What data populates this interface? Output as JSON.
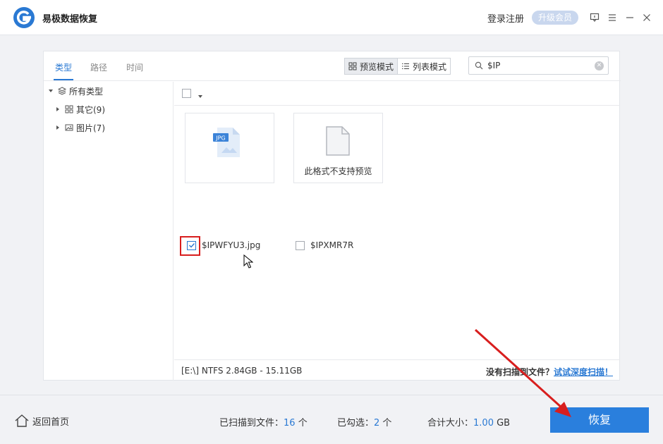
{
  "titlebar": {
    "app_title": "易极数据恢复",
    "login_label": "登录注册",
    "upgrade_label": "升级会员",
    "icons": [
      "feedback-icon",
      "menu-icon",
      "minimize-icon",
      "close-icon"
    ]
  },
  "tabs": [
    {
      "label": "类型",
      "active": true
    },
    {
      "label": "路径",
      "active": false
    },
    {
      "label": "时间",
      "active": false
    }
  ],
  "view_modes": {
    "preview_label": "预览模式",
    "list_label": "列表模式",
    "active": "preview"
  },
  "search": {
    "value": "$IP"
  },
  "tree": {
    "root": "所有类型",
    "children": [
      "其它(9)",
      "图片(7)"
    ]
  },
  "files": [
    {
      "name": "$IPWFYU3.jpg",
      "checked": true,
      "thumb_icon": "jpg-file-icon",
      "caption": ""
    },
    {
      "name": "$IPXMR7R",
      "checked": false,
      "thumb_icon": "blank-file-icon",
      "caption": "此格式不支持预览"
    }
  ],
  "status": {
    "drive_info": "[E:\\] NTFS 2.84GB - 15.11GB",
    "no_file_text": "没有扫描到文件？",
    "deep_scan_link": "试试深度扫描！"
  },
  "bottom": {
    "home_label": "返回首页",
    "scanned_label": "已扫描到文件：",
    "scanned_value": "16",
    "scanned_unit": " 个",
    "selected_label": "已勾选：",
    "selected_value": "2",
    "selected_unit": " 个",
    "size_label": "合计大小：",
    "size_value": "1.00",
    "size_unit": " GB",
    "recover_label": "恢复"
  },
  "colors": {
    "accent": "#2a79d3",
    "highlight_red": "#d81e1e",
    "upgrade_bg": "#c9d7ee"
  }
}
